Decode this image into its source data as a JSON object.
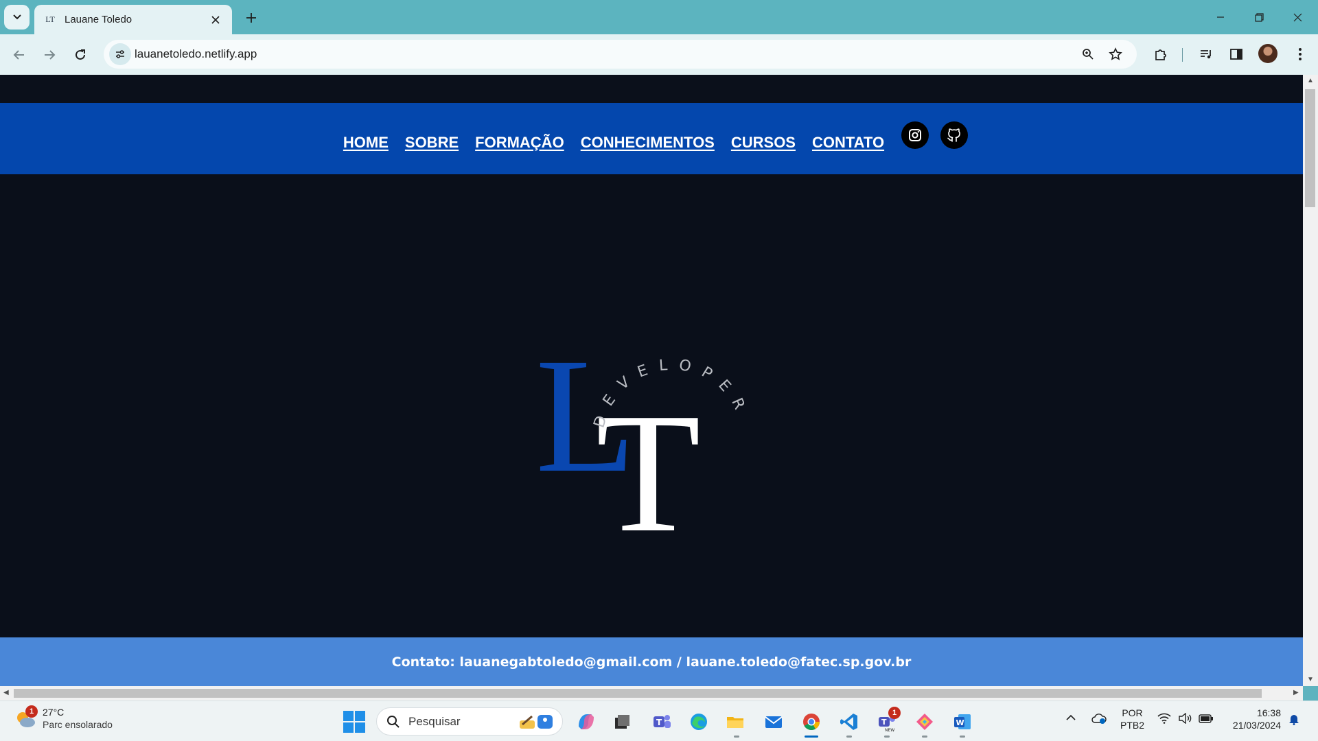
{
  "browser": {
    "tab_title": "Lauane Toledo",
    "tab_favicon_text": "LT",
    "url": "lauanetoledo.netlify.app"
  },
  "site": {
    "nav": [
      "HOME",
      "SOBRE",
      "FORMAÇÃO",
      "CONHECIMENTOS",
      "CURSOS",
      "CONTATO"
    ],
    "social": [
      "instagram-icon",
      "github-icon"
    ],
    "logo": {
      "letter_l": "L",
      "letter_t": "T",
      "arc_text": "DEVELOPER"
    },
    "footer_text": "Contato: lauanegabtoledo@gmail.com / lauane.toledo@fatec.sp.gov.br"
  },
  "colors": {
    "nav_bg": "#0447ad",
    "page_bg": "#0a0f1a",
    "footer_bg": "#4a87d8",
    "logo_blue": "#0a47b0"
  },
  "taskbar": {
    "weather_temp": "27°C",
    "weather_desc": "Parc ensolarado",
    "weather_badge": "1",
    "search_placeholder": "Pesquisar",
    "teams_badge": "1",
    "lang_top": "POR",
    "lang_bottom": "PTB2",
    "time": "16:38",
    "date": "21/03/2024"
  }
}
